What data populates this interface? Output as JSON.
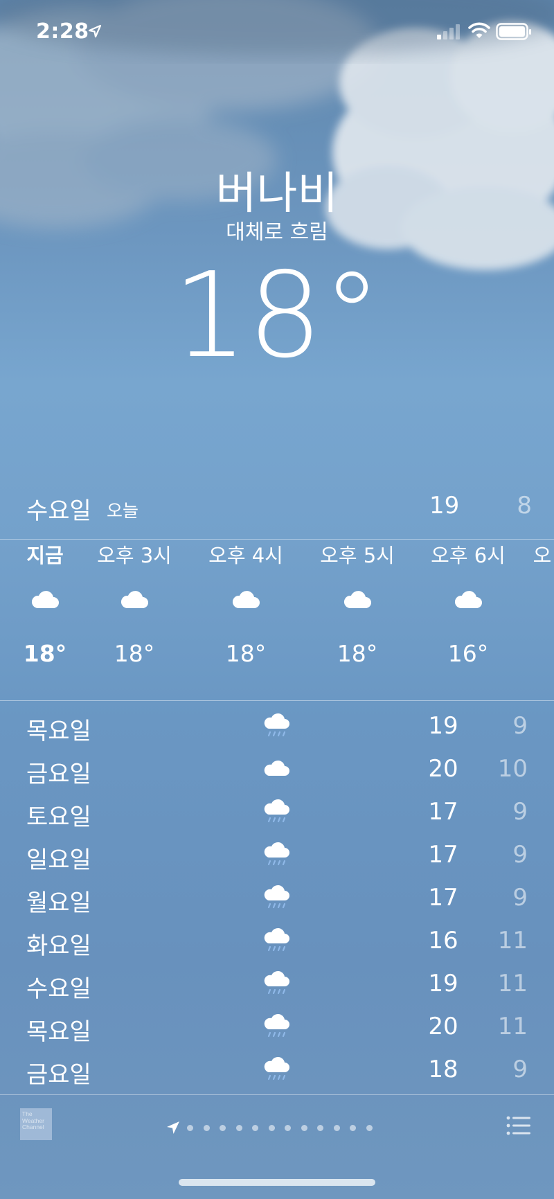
{
  "status_bar": {
    "time": "2:28"
  },
  "header": {
    "city": "버나비",
    "condition": "대체로 흐림",
    "temperature": "18°"
  },
  "today": {
    "day": "수요일",
    "label": "오늘",
    "high": "19",
    "low": "8"
  },
  "hourly": [
    {
      "label": "지금",
      "icon": "cloud-icon",
      "temp": "18°"
    },
    {
      "label": "오후 3시",
      "icon": "cloud-icon",
      "temp": "18°"
    },
    {
      "label": "오후 4시",
      "icon": "cloud-icon",
      "temp": "18°"
    },
    {
      "label": "오후 5시",
      "icon": "cloud-icon",
      "temp": "18°"
    },
    {
      "label": "오후 6시",
      "icon": "cloud-icon",
      "temp": "16°"
    },
    {
      "label": "오",
      "icon": "cloud-icon",
      "temp": ""
    }
  ],
  "daily": [
    {
      "day": "목요일",
      "icon": "rain-cloud-icon",
      "high": "19",
      "low": "9"
    },
    {
      "day": "금요일",
      "icon": "cloud-icon",
      "high": "20",
      "low": "10"
    },
    {
      "day": "토요일",
      "icon": "rain-cloud-icon",
      "high": "17",
      "low": "9"
    },
    {
      "day": "일요일",
      "icon": "rain-cloud-icon",
      "high": "17",
      "low": "9"
    },
    {
      "day": "월요일",
      "icon": "rain-cloud-icon",
      "high": "17",
      "low": "9"
    },
    {
      "day": "화요일",
      "icon": "rain-cloud-icon",
      "high": "16",
      "low": "11"
    },
    {
      "day": "수요일",
      "icon": "rain-cloud-icon",
      "high": "19",
      "low": "11"
    },
    {
      "day": "목요일",
      "icon": "rain-cloud-icon",
      "high": "20",
      "low": "11"
    },
    {
      "day": "금요일",
      "icon": "rain-cloud-icon",
      "high": "18",
      "low": "9"
    }
  ],
  "footer": {
    "logo_text": "The\nWeather\nChannel",
    "page_dots": 12
  }
}
